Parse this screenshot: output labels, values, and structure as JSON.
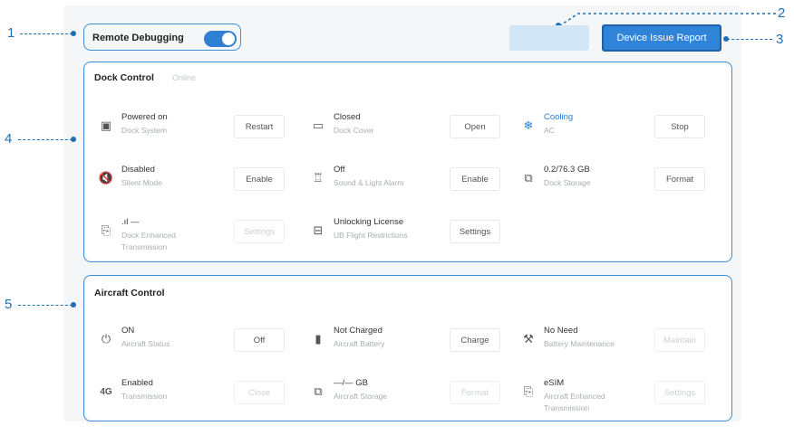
{
  "callouts": [
    "1",
    "2",
    "3",
    "4",
    "5"
  ],
  "remote_debugging": {
    "label": "Remote Debugging",
    "enabled": true
  },
  "toolbar": {
    "report_button": "Device Issue Report"
  },
  "dock": {
    "title": "Dock Control",
    "status": "Online",
    "items": [
      {
        "icon": "image-frame-icon",
        "glyph": "▣",
        "title": "Powered on",
        "sub": "Dock System",
        "button": "Restart",
        "disabled": false
      },
      {
        "icon": "dock-cover-icon",
        "glyph": "▭",
        "title": "Closed",
        "sub": "Dock Cover",
        "button": "Open",
        "disabled": false
      },
      {
        "icon": "ac-icon",
        "glyph": "❄",
        "title": "Cooling",
        "sub": "AC",
        "button": "Stop",
        "disabled": false,
        "blue": true
      },
      {
        "icon": "speaker-mute-icon",
        "glyph": "🔇",
        "title": "Disabled",
        "sub": "Silent Mode",
        "button": "Enable",
        "disabled": false
      },
      {
        "icon": "alarm-icon",
        "glyph": "♖",
        "title": "Off",
        "sub": "Sound & Light Alarm",
        "button": "Enable",
        "disabled": false
      },
      {
        "icon": "storage-icon",
        "glyph": "⧉",
        "title": "0.2/76.3 GB",
        "sub": "Dock Storage",
        "button": "Format",
        "disabled": false
      },
      {
        "icon": "transmission-file-icon",
        "glyph": "⎘",
        "title": ".ıl —",
        "sub": "Dock Enhanced",
        "sub2": "Transmission",
        "button": "Settings",
        "disabled": true
      },
      {
        "icon": "license-icon",
        "glyph": "⊟",
        "title": "Unlocking License",
        "sub": "UB Flight Restrictions",
        "button": "Settings",
        "disabled": false
      }
    ]
  },
  "aircraft": {
    "title": "Aircraft Control",
    "items": [
      {
        "icon": "power-icon",
        "glyph": "⏻",
        "title": "ON",
        "sub": "Aircraft Status",
        "button": "Off",
        "disabled": false
      },
      {
        "icon": "battery-icon",
        "glyph": "▮",
        "title": "Not Charged",
        "sub": "Aircraft Battery",
        "button": "Charge",
        "disabled": false
      },
      {
        "icon": "battery-maintenance-icon",
        "glyph": "⚒",
        "title": "No Need",
        "sub": "Battery Maintenance",
        "button": "Maintain",
        "disabled": true
      },
      {
        "icon": "network-4g-icon",
        "glyph": "4G",
        "title": "Enabled",
        "sub": "Transmission",
        "button": "Close",
        "disabled": true
      },
      {
        "icon": "aircraft-storage-icon",
        "glyph": "⧉",
        "title": "—/— GB",
        "sub": "Aircraft Storage",
        "button": "Format",
        "disabled": true
      },
      {
        "icon": "esim-icon",
        "glyph": "⎘",
        "title": "eSIM",
        "sub": "Aircraft Enhanced",
        "sub2": "Transmission",
        "button": "Settings",
        "disabled": true
      }
    ]
  }
}
